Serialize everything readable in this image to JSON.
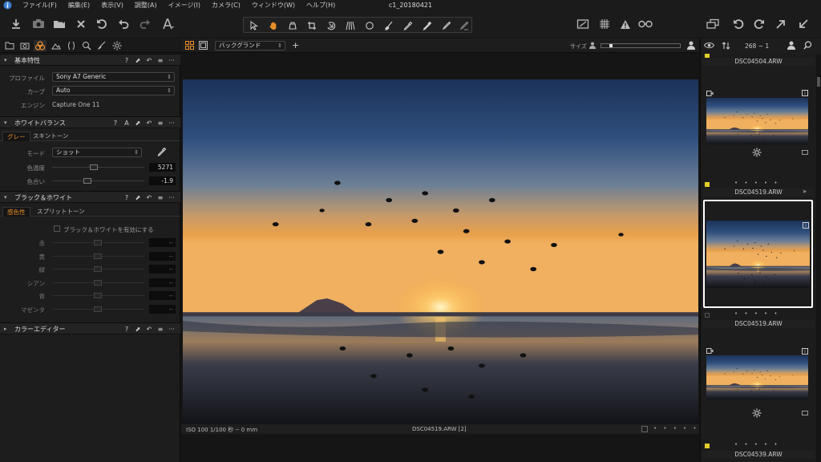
{
  "menu": {
    "items": [
      "ファイル(F)",
      "編集(E)",
      "表示(V)",
      "調整(A)",
      "イメージ(I)",
      "カメラ(C)",
      "ウィンドウ(W)",
      "ヘルプ(H)"
    ],
    "title": "c1_20180421"
  },
  "left": {
    "basic": {
      "title": "基本特性",
      "profile_label": "プロファイル",
      "profile_value": "Sony A7 Generic",
      "curve_label": "カーブ",
      "curve_value": "Auto",
      "engine_label": "エンジン",
      "engine_value": "Capture One 11"
    },
    "wb": {
      "title": "ホワイトバランス",
      "tab_gray": "グレー",
      "tab_skin": "スキントーン",
      "mode_label": "モード",
      "mode_value": "ショット",
      "kelvin_label": "色温度",
      "kelvin_value": "5271",
      "tint_label": "色合い",
      "tint_value": "-1.9",
      "kelvin_pos": 0.45,
      "tint_pos": 0.37
    },
    "bw": {
      "title": "ブラック＆ホワイト",
      "tab_sens": "感色性",
      "tab_split": "スプリットトーン",
      "enable_label": "ブラック＆ホワイトを有効にする",
      "channels": [
        "赤",
        "黄",
        "緑",
        "シアン",
        "青",
        "マゼンタ"
      ],
      "dash": "--"
    },
    "color": {
      "title": "カラーエディター"
    }
  },
  "viewer": {
    "variant_label": "バックグランド",
    "size_label": "サイズ",
    "status_left": "ISO 100   1/100 秒   --   0 mm",
    "status_center": "DSC04519.ARW [2]",
    "status_dots": "• • • • •"
  },
  "browser": {
    "count": "268 ~ 1",
    "dots": "• • • • •",
    "thumbs": [
      {
        "name": "DSC04504.ARW"
      },
      {
        "name": "DSC04519.ARW"
      },
      {
        "name": "DSC04519.ARW"
      },
      {
        "name": "DSC04539.ARW"
      }
    ]
  },
  "colors": {
    "accent": "#e88f2a",
    "bg": "#1d1d1d",
    "selected": "#ffffff",
    "tag": "#e3cf2a"
  }
}
